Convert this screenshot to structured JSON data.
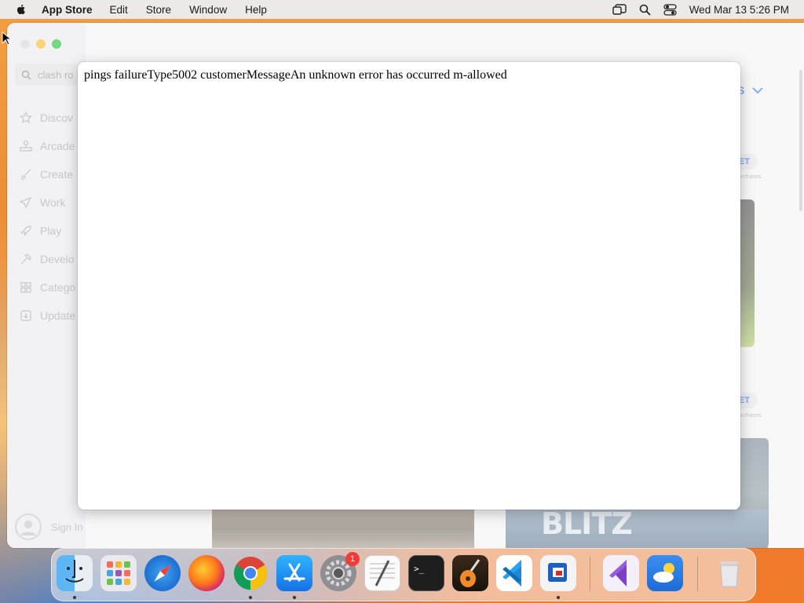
{
  "menubar": {
    "app_name": "App Store",
    "menus": [
      "Edit",
      "Store",
      "Window",
      "Help"
    ],
    "clock": "Wed Mar 13  5:26 PM"
  },
  "sidebar": {
    "search_value": "clash ro",
    "items": [
      {
        "label": "Discov",
        "icon": "star-icon"
      },
      {
        "label": "Arcade",
        "icon": "arcade-icon"
      },
      {
        "label": "Create",
        "icon": "brush-icon"
      },
      {
        "label": "Work",
        "icon": "paper-plane-icon"
      },
      {
        "label": "Play",
        "icon": "rocket-icon"
      },
      {
        "label": "Develo",
        "icon": "hammer-icon"
      },
      {
        "label": "Catego",
        "icon": "grid-icon"
      },
      {
        "label": "Update",
        "icon": "download-icon"
      }
    ],
    "sign_in": "Sign In"
  },
  "content": {
    "see_all_fragment": "S",
    "get_fragment_1": "ET",
    "get_fragment_2": "ET",
    "in_app_fragment": "urchases",
    "blitz_text": "BLITZ"
  },
  "dialog": {
    "message": "pings failureType5002 customerMessageAn unknown error has occurred m-allowed"
  },
  "dock": {
    "apps": [
      {
        "name": "finder-icon",
        "running": true
      },
      {
        "name": "launchpad-icon",
        "running": false
      },
      {
        "name": "safari-icon",
        "running": false
      },
      {
        "name": "firefox-icon",
        "running": false
      },
      {
        "name": "chrome-icon",
        "running": true
      },
      {
        "name": "app-store-icon",
        "running": true
      },
      {
        "name": "system-settings-icon",
        "running": false,
        "badge": "1"
      },
      {
        "name": "textedit-icon",
        "running": false
      },
      {
        "name": "terminal-icon",
        "running": false
      },
      {
        "name": "garageband-icon",
        "running": false
      },
      {
        "name": "vscode-icon",
        "running": false
      },
      {
        "name": "remote-desktop-icon",
        "running": true
      },
      {
        "name": "visual-studio-icon",
        "running": false
      },
      {
        "name": "weather-icon",
        "running": false
      },
      {
        "name": "trash-icon",
        "running": false
      }
    ]
  }
}
